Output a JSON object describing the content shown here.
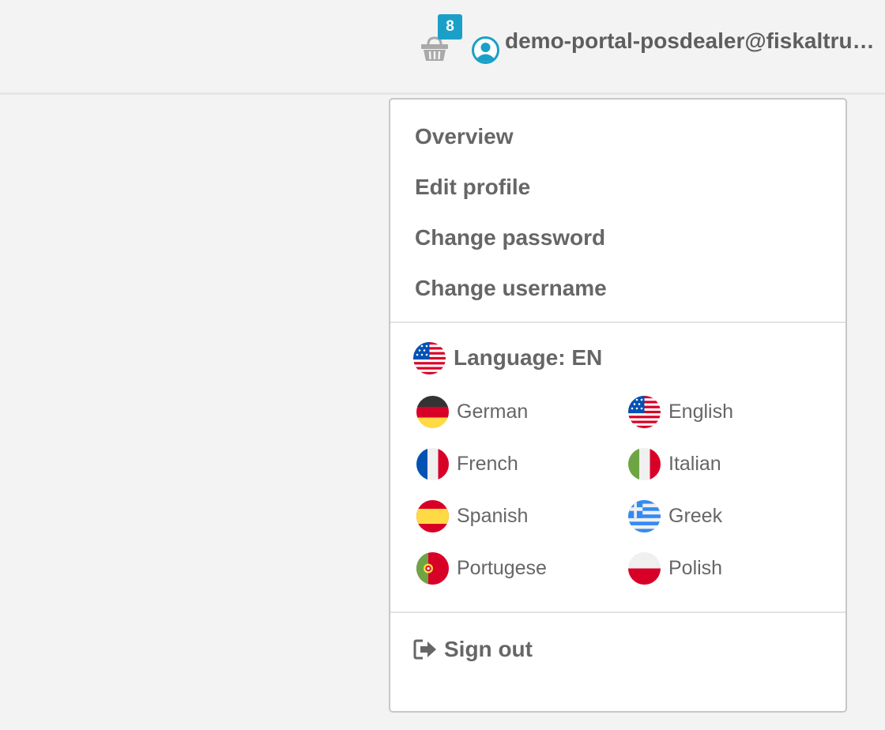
{
  "header": {
    "cart_icon": "basket-icon",
    "cart_badge": "8",
    "user_icon": "user-circle-icon",
    "user_name": "demo-portal-posdealer@fiskaltrust.de",
    "accent_color": "#1aa0c8"
  },
  "menu": {
    "items": [
      {
        "label": "Overview"
      },
      {
        "label": "Edit profile"
      },
      {
        "label": "Change password"
      },
      {
        "label": "Change username"
      }
    ],
    "language": {
      "current_label": "Language: EN",
      "current_flag": "us-flag-icon",
      "options": [
        {
          "label": "German",
          "flag": "de-flag-icon"
        },
        {
          "label": "English",
          "flag": "us-flag-icon"
        },
        {
          "label": "French",
          "flag": "fr-flag-icon"
        },
        {
          "label": "Italian",
          "flag": "it-flag-icon"
        },
        {
          "label": "Spanish",
          "flag": "es-flag-icon"
        },
        {
          "label": "Greek",
          "flag": "gr-flag-icon"
        },
        {
          "label": "Portugese",
          "flag": "pt-flag-icon"
        },
        {
          "label": "Polish",
          "flag": "pl-flag-icon"
        }
      ]
    },
    "sign_out": {
      "label": "Sign out",
      "icon": "sign-out-icon"
    }
  }
}
